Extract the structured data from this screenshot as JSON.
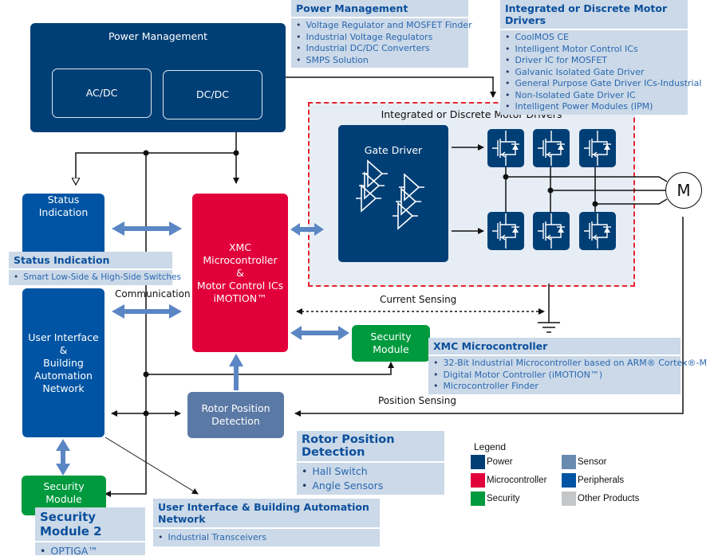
{
  "diagram": {
    "blocks": {
      "power_management": {
        "title": "Power Management",
        "acdc": "AC/DC",
        "dcdc": "DC/DC"
      },
      "status_indication": "Status\nIndication",
      "user_interface": "User Interface\n&\nBuilding\nAutomation\nNetwork",
      "security_module_left": "Security\nModule",
      "mcu": "XMC\nMicrocontroller\n&\nMotor Control ICs\niMOTION™",
      "security_module_right": "Security\nModule",
      "rotor_position": "Rotor Position\nDetection",
      "motor_drivers_group": "Integrated or Discrete Motor Drivers",
      "gate_driver": "Gate Driver",
      "motor": "M"
    },
    "labels": {
      "communication": "Communication",
      "current_sensing": "Current Sensing",
      "position_sensing": "Position Sensing"
    },
    "info_boxes": {
      "power_management": {
        "title": "Power Management",
        "items": [
          "Voltage Regulator and MOSFET Finder",
          "Industrial Voltage Regulators",
          "Industrial DC/DC Converters",
          "SMPS Solution"
        ]
      },
      "motor_drivers": {
        "title": "Integrated or Discrete Motor Drivers",
        "items": [
          "CoolMOS CE",
          "Intelligent Motor Control ICs",
          "Driver IC for MOSFET",
          "Galvanic Isolated Gate Driver",
          "General Purpose Gate Driver ICs-Industrial",
          "Non-Isolated Gate Driver IC",
          "Intelligent Power Modules (IPM)"
        ]
      },
      "status_indication": {
        "title": "Status Indication",
        "items": [
          "Smart Low-Side & High-Side Switches"
        ]
      },
      "xmc_microcontroller": {
        "title": "XMC Microcontroller",
        "items": [
          "32-Bit Industrial Microcontroller based on ARM® Cortex®-M",
          "Digital Motor Controller (iMOTION™)",
          "Microcontroller Finder"
        ]
      },
      "rotor_position": {
        "title": "Rotor Position Detection",
        "items": [
          "Hall Switch",
          "Angle Sensors"
        ]
      },
      "user_interface": {
        "title": "User Interface & Building Automation Network",
        "items": [
          "Industrial Transceivers"
        ]
      },
      "security_module_2": {
        "title": "Security Module 2",
        "items": [
          "OPTIGA™"
        ]
      }
    },
    "legend": {
      "title": "Legend",
      "items": [
        {
          "label": "Power",
          "color": "#003f76"
        },
        {
          "label": "Sensor",
          "color": "#6a8bb0"
        },
        {
          "label": "Microcontroller",
          "color": "#e2003b"
        },
        {
          "label": "Peripherals",
          "color": "#0054a3"
        },
        {
          "label": "Security",
          "color": "#009a3e"
        },
        {
          "label": "Other Products",
          "color": "#c4c6c8"
        }
      ]
    }
  }
}
